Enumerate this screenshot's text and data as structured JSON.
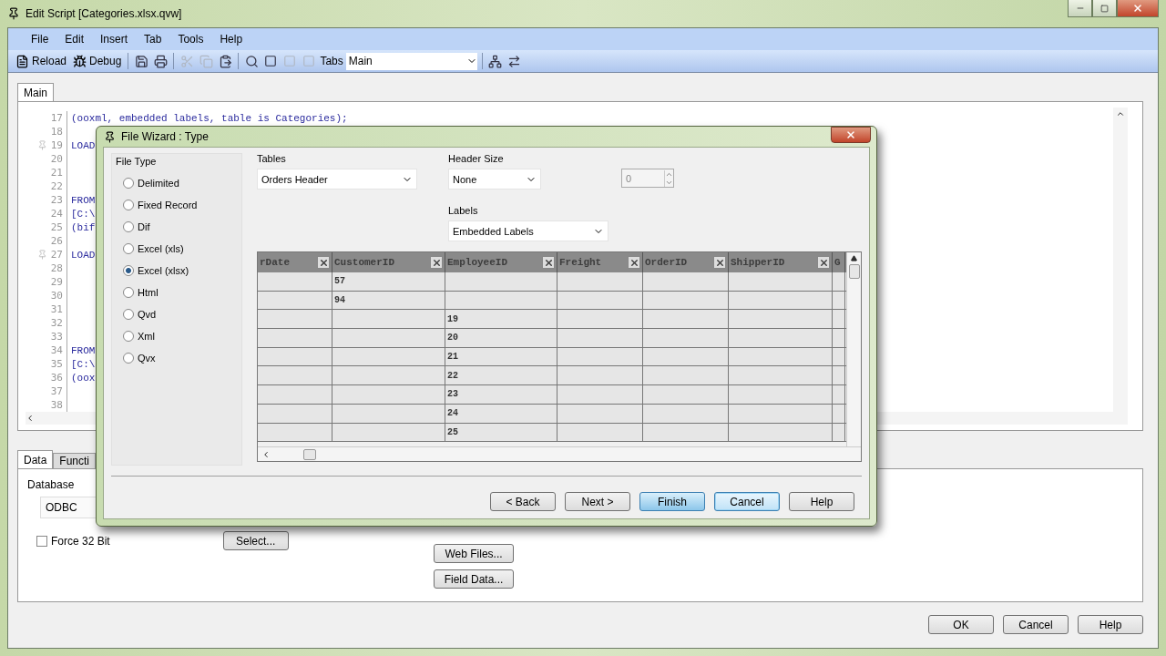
{
  "window": {
    "title": "Edit Script [Categories.xlsx.qvw]"
  },
  "menu": [
    "File",
    "Edit",
    "Insert",
    "Tab",
    "Tools",
    "Help"
  ],
  "toolbar": {
    "reload": "Reload",
    "debug": "Debug",
    "tabs_label": "Tabs",
    "tabs_value": "Main"
  },
  "editor_tabs": [
    {
      "label": "Main",
      "selected": true
    }
  ],
  "editor": {
    "lines": [
      {
        "no": "17",
        "code": "(ooxml, embedded labels, table is Categories);"
      },
      {
        "no": "18"
      },
      {
        "no": "19",
        "code": "LOAD",
        "bookmark": true
      },
      {
        "no": "20"
      },
      {
        "no": "21"
      },
      {
        "no": "22"
      },
      {
        "no": "23",
        "code": "FROM"
      },
      {
        "no": "24",
        "code": "[C:\\"
      },
      {
        "no": "25",
        "code": "(bif"
      },
      {
        "no": "26"
      },
      {
        "no": "27",
        "code": "LOAD",
        "bookmark": true
      },
      {
        "no": "28"
      },
      {
        "no": "29"
      },
      {
        "no": "30"
      },
      {
        "no": "31"
      },
      {
        "no": "32"
      },
      {
        "no": "33"
      },
      {
        "no": "34",
        "code": "FROM"
      },
      {
        "no": "35",
        "code": "[C:\\"
      },
      {
        "no": "36",
        "code": "(oox"
      },
      {
        "no": "37"
      },
      {
        "no": "38"
      }
    ]
  },
  "bottom_tabs": [
    {
      "label": "Data",
      "selected": true
    },
    {
      "label": "Functi",
      "selected": false
    }
  ],
  "data_panel": {
    "database_label": "Database",
    "database_value": "ODBC",
    "force32": {
      "label": "Force 32 Bit",
      "checked": false
    },
    "select_button": "Select...",
    "buttons": [
      "Web Files...",
      "Field Data..."
    ]
  },
  "footer_buttons": [
    "OK",
    "Cancel",
    "Help"
  ],
  "dialog": {
    "title": "File Wizard : Type",
    "file_type": {
      "label": "File Type",
      "options": [
        {
          "label": "Delimited",
          "selected": false
        },
        {
          "label": "Fixed Record",
          "selected": false
        },
        {
          "label": "Dif",
          "selected": false
        },
        {
          "label": "Excel (xls)",
          "selected": false
        },
        {
          "label": "Excel (xlsx)",
          "selected": true
        },
        {
          "label": "Html",
          "selected": false
        },
        {
          "label": "Qvd",
          "selected": false
        },
        {
          "label": "Xml",
          "selected": false
        },
        {
          "label": "Qvx",
          "selected": false
        }
      ]
    },
    "tables": {
      "label": "Tables",
      "value": "Orders Header"
    },
    "header_size": {
      "label": "Header Size",
      "value": "None",
      "count": "0"
    },
    "labels": {
      "label": "Labels",
      "value": "Embedded Labels"
    },
    "grid": {
      "columns": [
        "rDate",
        "CustomerID",
        "EmployeeID",
        "Freight",
        "OrderID",
        "ShipperID",
        "G"
      ],
      "rows": [
        [
          "",
          "57",
          "",
          "",
          "",
          "",
          ""
        ],
        [
          "",
          "94",
          "",
          "",
          "",
          "",
          ""
        ],
        [
          "",
          "",
          "19",
          "",
          "",
          "",
          ""
        ],
        [
          "",
          "",
          "20",
          "",
          "",
          "",
          ""
        ],
        [
          "",
          "",
          "21",
          "",
          "",
          "",
          ""
        ],
        [
          "",
          "",
          "22",
          "",
          "",
          "",
          ""
        ],
        [
          "",
          "",
          "23",
          "",
          "",
          "",
          ""
        ],
        [
          "",
          "",
          "24",
          "",
          "",
          "",
          ""
        ],
        [
          "",
          "",
          "25",
          "",
          "",
          "",
          ""
        ]
      ]
    },
    "buttons": [
      {
        "label": "< Back",
        "kind": "normal"
      },
      {
        "label": "Next >",
        "kind": "normal"
      },
      {
        "label": "Finish",
        "kind": "pressed"
      },
      {
        "label": "Cancel",
        "kind": "focused"
      },
      {
        "label": "Help",
        "kind": "normal"
      }
    ]
  }
}
